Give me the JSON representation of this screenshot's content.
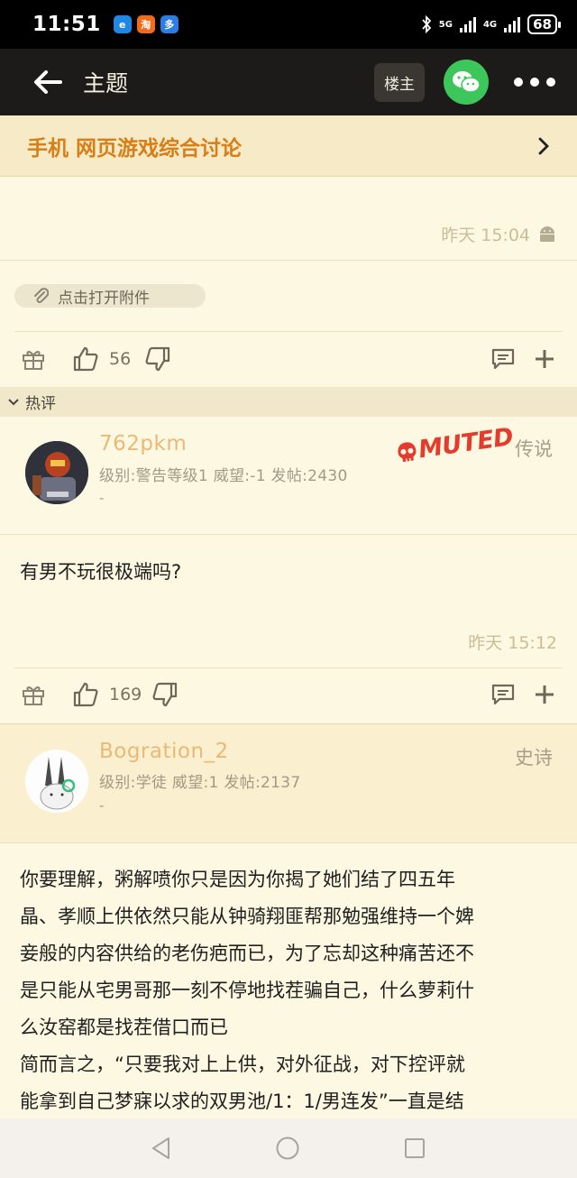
{
  "status_bar": {
    "time": "11:51",
    "network_1": "5G",
    "network_2": "4G",
    "battery": "68"
  },
  "nav": {
    "title": "主题",
    "owner_button": "楼主"
  },
  "forum": {
    "name": "手机 网页游戏综合讨论"
  },
  "first_post": {
    "time": "昨天 15:04",
    "attachment_label": "点击打开附件",
    "likes": "56"
  },
  "hot_section": {
    "label": "热评"
  },
  "reply1": {
    "username": "762pkm",
    "meta": "级别:警告等级1 威望:-1 发帖:2430",
    "dash": "-",
    "rank": "传说",
    "muted_badge": "MUTED",
    "content": "有男不玩很极端吗?",
    "time": "昨天 15:12",
    "likes": "169"
  },
  "reply2": {
    "username": "Bogration_2",
    "meta": "级别:学徒 威望:1 发帖:2137",
    "dash": "-",
    "rank": "史诗",
    "content_lines": [
      "你要理解，粥解喷你只是因为你揭了她们结了四五年",
      "晶、孝顺上供依然只能从钟骑翔匪帮那勉强维持一个婢",
      "妾般的内容供给的老伤疤而已，为了忘却这种痛苦还不",
      "是只能从宅男哥那一刻不停地找茬骗自己，什么萝莉什",
      "么汝窑都是找茬借口而已",
      "简而言之，“只要我对上上供，对外征战，对下控评就",
      "能拿到自己梦寐以求的双男池/1：1/男连发”一直是结"
    ]
  },
  "colors": {
    "accent_orange": "#d97e17",
    "username": "#e9b977",
    "wechat_green": "#3dc75a",
    "muted_red": "#e53b2c"
  }
}
